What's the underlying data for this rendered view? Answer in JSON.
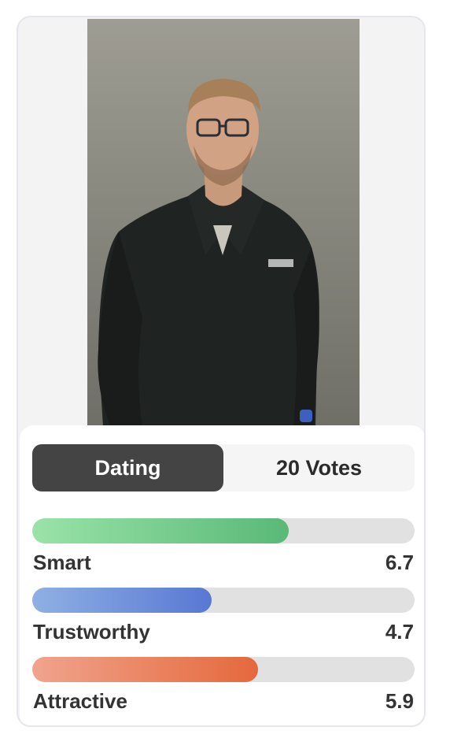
{
  "photo": {
    "alt": "Profile photo of a man with glasses in a dark polo shirt"
  },
  "tabs": [
    {
      "label": "Dating",
      "active": true
    },
    {
      "label": "20 Votes",
      "active": false
    }
  ],
  "metrics": [
    {
      "label": "Smart",
      "value": "6.7",
      "fraction": 0.67,
      "color_start": "#9ae3a8",
      "color_end": "#59b977"
    },
    {
      "label": "Trustworthy",
      "value": "4.7",
      "fraction": 0.47,
      "color_start": "#8fb0e4",
      "color_end": "#5878d3"
    },
    {
      "label": "Attractive",
      "value": "5.9",
      "fraction": 0.59,
      "color_start": "#f0a48d",
      "color_end": "#e5683c"
    }
  ]
}
